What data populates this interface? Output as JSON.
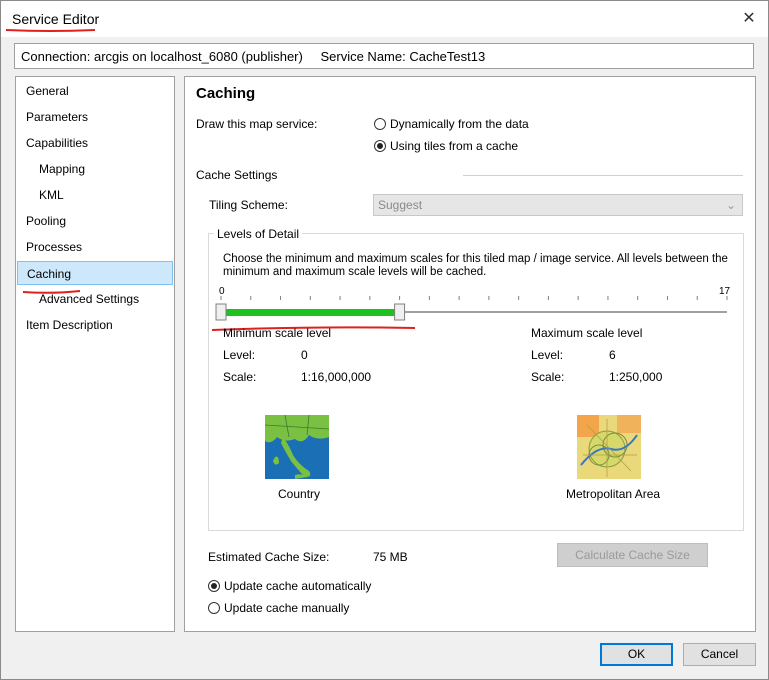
{
  "window": {
    "title": "Service Editor",
    "close_glyph": "✕"
  },
  "connection": {
    "text": "Connection: arcgis on localhost_6080 (publisher)",
    "service_name": "Service Name: CacheTest13"
  },
  "nav": {
    "items": [
      {
        "label": "General",
        "sub": false,
        "selected": false
      },
      {
        "label": "Parameters",
        "sub": false,
        "selected": false
      },
      {
        "label": "Capabilities",
        "sub": false,
        "selected": false
      },
      {
        "label": "Mapping",
        "sub": true,
        "selected": false
      },
      {
        "label": "KML",
        "sub": true,
        "selected": false
      },
      {
        "label": "Pooling",
        "sub": false,
        "selected": false
      },
      {
        "label": "Processes",
        "sub": false,
        "selected": false
      },
      {
        "label": "Caching",
        "sub": false,
        "selected": true
      },
      {
        "label": "Advanced Settings",
        "sub": true,
        "selected": false
      },
      {
        "label": "Item Description",
        "sub": false,
        "selected": false
      }
    ]
  },
  "caching": {
    "heading": "Caching",
    "draw_label": "Draw this map service:",
    "radio_dynamic": "Dynamically from the data",
    "radio_tiles": "Using tiles from a cache",
    "draw_mode": "tiles",
    "cache_settings": "Cache Settings",
    "tiling_label": "Tiling Scheme:",
    "tiling_value": "Suggest",
    "lod": {
      "legend": "Levels of Detail",
      "description": "Choose the minimum and maximum scales for this tiled map / image service. All levels between the minimum and maximum scale levels will be cached.",
      "slider_min_label": "0",
      "slider_max_label": "17",
      "slider_total": 17,
      "slider_low": 0,
      "slider_high": 6,
      "min": {
        "title": "Minimum scale level",
        "level_label": "Level:",
        "level_value": "0",
        "scale_label": "Scale:",
        "scale_value": "1:16,000,000",
        "thumb_caption": "Country"
      },
      "max": {
        "title": "Maximum scale level",
        "level_label": "Level:",
        "level_value": "6",
        "scale_label": "Scale:",
        "scale_value": "1:250,000",
        "thumb_caption": "Metropolitan Area"
      }
    },
    "estimated_label": "Estimated Cache Size:",
    "estimated_value": "75 MB",
    "calc_button": "Calculate Cache Size",
    "update_auto": "Update cache automatically",
    "update_manual": "Update cache manually",
    "update_mode": "auto"
  },
  "footer": {
    "ok": "OK",
    "cancel": "Cancel"
  },
  "colors": {
    "accent": "#0078d7",
    "slider_fill": "#1ec21e",
    "annotation": "#e02020",
    "selected_bg": "#cde8fb"
  }
}
